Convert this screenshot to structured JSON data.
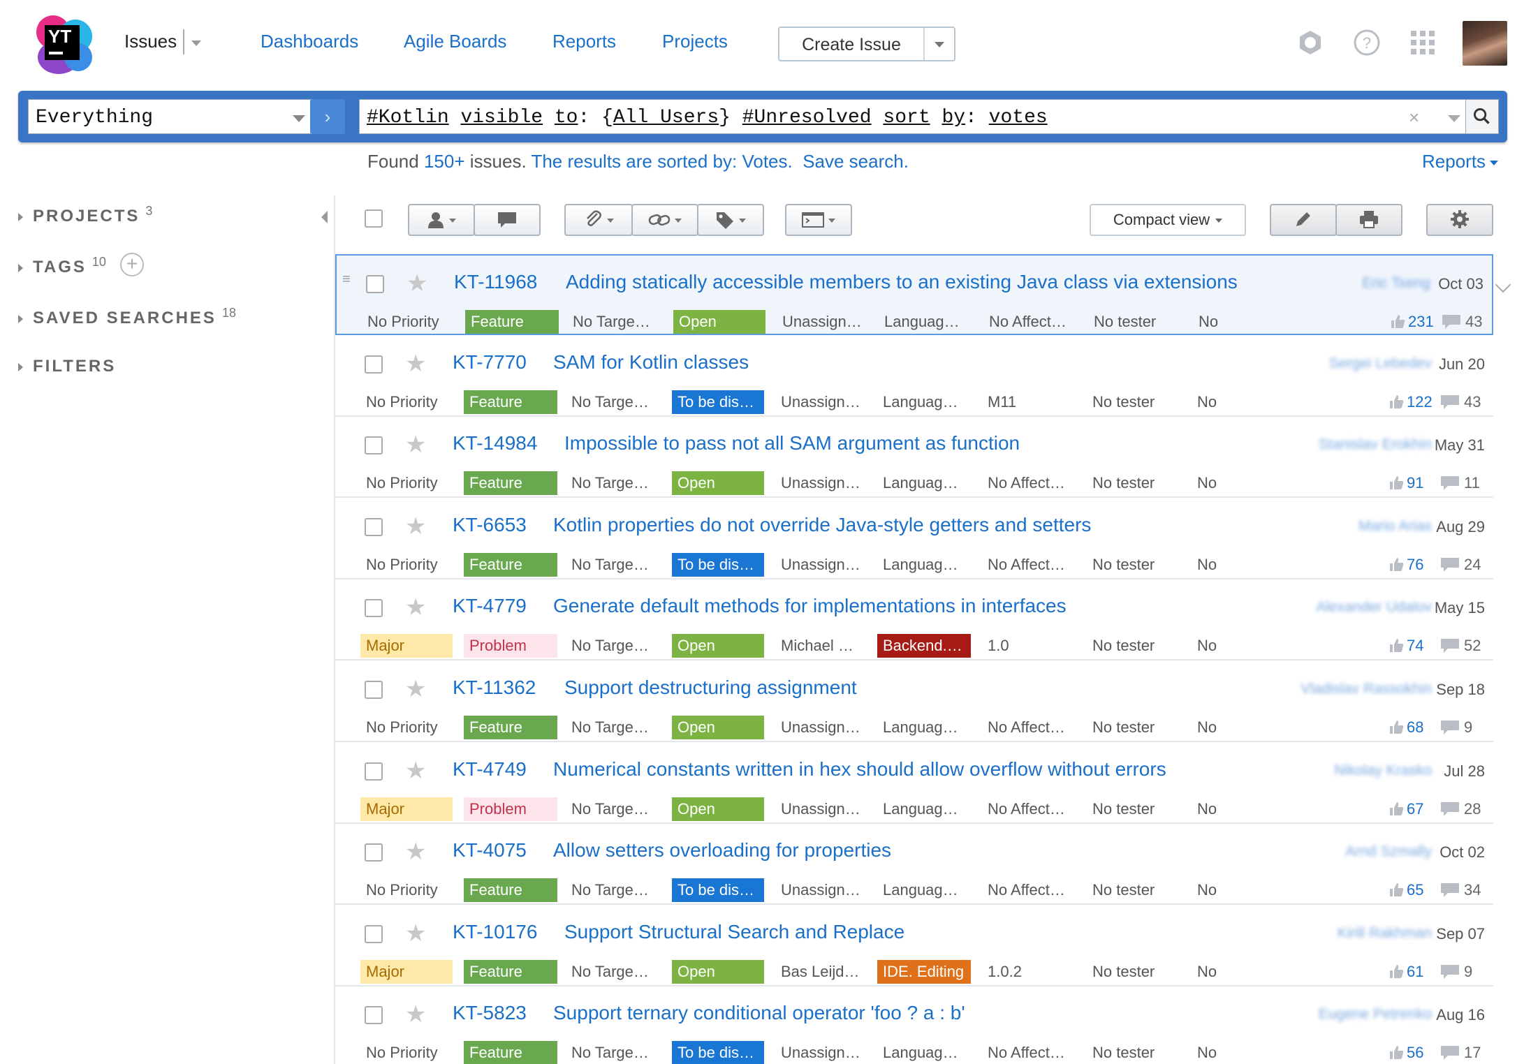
{
  "header": {
    "issues_label": "Issues",
    "nav": [
      "Dashboards",
      "Agile Boards",
      "Reports",
      "Projects"
    ],
    "create_issue": "Create Issue",
    "logo_text": "YT",
    "icons": [
      "hub-icon",
      "help-icon",
      "apps-grid-icon"
    ]
  },
  "search": {
    "context": "Everything",
    "query_parts": [
      {
        "t": "#Kotlin",
        "u": true
      },
      {
        "t": " ",
        "u": false
      },
      {
        "t": "visible",
        "u": true
      },
      {
        "t": " ",
        "u": false
      },
      {
        "t": "to",
        "u": true
      },
      {
        "t": ": {",
        "u": false
      },
      {
        "t": "All Users",
        "u": true
      },
      {
        "t": "} ",
        "u": false
      },
      {
        "t": "#Unresolved",
        "u": true
      },
      {
        "t": " ",
        "u": false
      },
      {
        "t": "sort",
        "u": true
      },
      {
        "t": " ",
        "u": false
      },
      {
        "t": "by",
        "u": true
      },
      {
        "t": ": ",
        "u": false
      },
      {
        "t": "votes",
        "u": true
      }
    ],
    "clear": "×",
    "found_prefix": "Found ",
    "found_count": "150+",
    "found_mid": " issues. ",
    "sorted_text": "The results are sorted by: Votes.",
    "save_search": "Save search.",
    "reports": "Reports"
  },
  "sidebar": {
    "items": [
      {
        "label": "PROJECTS",
        "count": "3"
      },
      {
        "label": "TAGS",
        "count": "10"
      },
      {
        "label": "SAVED SEARCHES",
        "count": "18"
      },
      {
        "label": "FILTERS",
        "count": ""
      }
    ]
  },
  "toolbar": {
    "compact_view": "Compact view"
  },
  "colors": {
    "link": "#1a6fc9",
    "feature": "#6aa84f",
    "open": "#7cb342",
    "to_be_discussed": "#1976d2",
    "major": "#ffe9a8",
    "problem": "#fde3ea",
    "backend": "#a61c14",
    "ide_editing": "#e0711b"
  },
  "issues": [
    {
      "id": "KT-11968",
      "summary": "Adding statically accessible members to an existing Java class via extensions",
      "reporter": "Eric Tseng",
      "date": "Oct 03",
      "priority": "No Priority",
      "type": "Feature",
      "target": "No Targe…",
      "state": "Open",
      "assignee": "Unassign…",
      "subsystem": "Languag…",
      "affected": "No Affect…",
      "tester": "No tester",
      "flag": "No",
      "votes": "231",
      "comments": "43"
    },
    {
      "id": "KT-7770",
      "summary": "SAM for Kotlin classes",
      "reporter": "Sergei Lebedev",
      "date": "Jun 20",
      "priority": "No Priority",
      "type": "Feature",
      "target": "No Targe…",
      "state": "To be dis…",
      "assignee": "Unassign…",
      "subsystem": "Languag…",
      "affected": "M11",
      "tester": "No tester",
      "flag": "No",
      "votes": "122",
      "comments": "43"
    },
    {
      "id": "KT-14984",
      "summary": "Impossible to pass not all SAM argument as function",
      "reporter": "Stanislav Erokhin",
      "date": "May 31",
      "priority": "No Priority",
      "type": "Feature",
      "target": "No Targe…",
      "state": "Open",
      "assignee": "Unassign…",
      "subsystem": "Languag…",
      "affected": "No Affect…",
      "tester": "No tester",
      "flag": "No",
      "votes": "91",
      "comments": "11"
    },
    {
      "id": "KT-6653",
      "summary": "Kotlin properties do not override Java-style getters and setters",
      "reporter": "Mario Arias",
      "date": "Aug 29",
      "priority": "No Priority",
      "type": "Feature",
      "target": "No Targe…",
      "state": "To be dis…",
      "assignee": "Unassign…",
      "subsystem": "Languag…",
      "affected": "No Affect…",
      "tester": "No tester",
      "flag": "No",
      "votes": "76",
      "comments": "24"
    },
    {
      "id": "KT-4779",
      "summary": "Generate default methods for implementations in interfaces",
      "reporter": "Alexander Udalov",
      "date": "May 15",
      "priority": "Major",
      "type": "Problem",
      "target": "No Targe…",
      "state": "Open",
      "assignee": "Michael …",
      "subsystem": "Backend.…",
      "affected": "1.0",
      "tester": "No tester",
      "flag": "No",
      "votes": "74",
      "comments": "52"
    },
    {
      "id": "KT-11362",
      "summary": "Support destructuring assignment",
      "reporter": "Vladislav Rassokhin",
      "date": "Sep 18",
      "priority": "No Priority",
      "type": "Feature",
      "target": "No Targe…",
      "state": "Open",
      "assignee": "Unassign…",
      "subsystem": "Languag…",
      "affected": "No Affect…",
      "tester": "No tester",
      "flag": "No",
      "votes": "68",
      "comments": "9"
    },
    {
      "id": "KT-4749",
      "summary": "Numerical constants written in hex should allow overflow without errors",
      "reporter": "Nikolay Krasko",
      "date": "Jul 28",
      "priority": "Major",
      "type": "Problem",
      "target": "No Targe…",
      "state": "Open",
      "assignee": "Unassign…",
      "subsystem": "Languag…",
      "affected": "No Affect…",
      "tester": "No tester",
      "flag": "No",
      "votes": "67",
      "comments": "28"
    },
    {
      "id": "KT-4075",
      "summary": "Allow setters overloading for properties",
      "reporter": "Arnd Szmally",
      "date": "Oct 02",
      "priority": "No Priority",
      "type": "Feature",
      "target": "No Targe…",
      "state": "To be dis…",
      "assignee": "Unassign…",
      "subsystem": "Languag…",
      "affected": "No Affect…",
      "tester": "No tester",
      "flag": "No",
      "votes": "65",
      "comments": "34"
    },
    {
      "id": "KT-10176",
      "summary": "Support Structural Search and Replace",
      "reporter": "Kirill Rakhman",
      "date": "Sep 07",
      "priority": "Major",
      "type": "Feature",
      "target": "No Targe…",
      "state": "Open",
      "assignee": "Bas Leijd…",
      "subsystem": "IDE. Editing",
      "affected": "1.0.2",
      "tester": "No tester",
      "flag": "No",
      "votes": "61",
      "comments": "9"
    },
    {
      "id": "KT-5823",
      "summary": "Support ternary conditional operator 'foo ? a : b'",
      "reporter": "Eugene Petrenko",
      "date": "Aug 16",
      "priority": "No Priority",
      "type": "Feature",
      "target": "No Targe…",
      "state": "To be dis…",
      "assignee": "Unassign…",
      "subsystem": "Languag…",
      "affected": "No Affect…",
      "tester": "No tester",
      "flag": "No",
      "votes": "56",
      "comments": "17"
    }
  ]
}
